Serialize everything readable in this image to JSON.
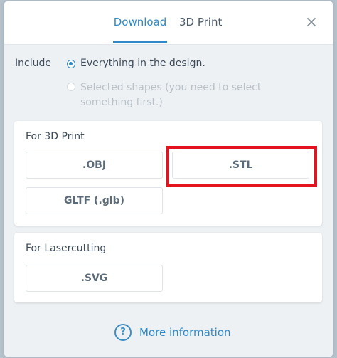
{
  "header": {
    "tabs": [
      {
        "label": "Download",
        "active": true
      },
      {
        "label": "3D Print",
        "active": false
      }
    ],
    "close_glyph": "×"
  },
  "include": {
    "label": "Include",
    "options": [
      {
        "label": "Everything in the design.",
        "selected": true
      },
      {
        "label": "Selected shapes (you need to select something first.)",
        "selected": false,
        "disabled": true
      }
    ]
  },
  "sections": {
    "print3d": {
      "title": "For 3D Print",
      "buttons": [
        ".OBJ",
        ".STL",
        "GLTF (.glb)"
      ]
    },
    "laser": {
      "title": "For Lasercutting",
      "buttons": [
        ".SVG"
      ]
    }
  },
  "footer": {
    "more_info_label": "More information",
    "help_icon_glyph": "?"
  },
  "colors": {
    "accent": "#2f88c8",
    "highlight": "#e3141d"
  }
}
